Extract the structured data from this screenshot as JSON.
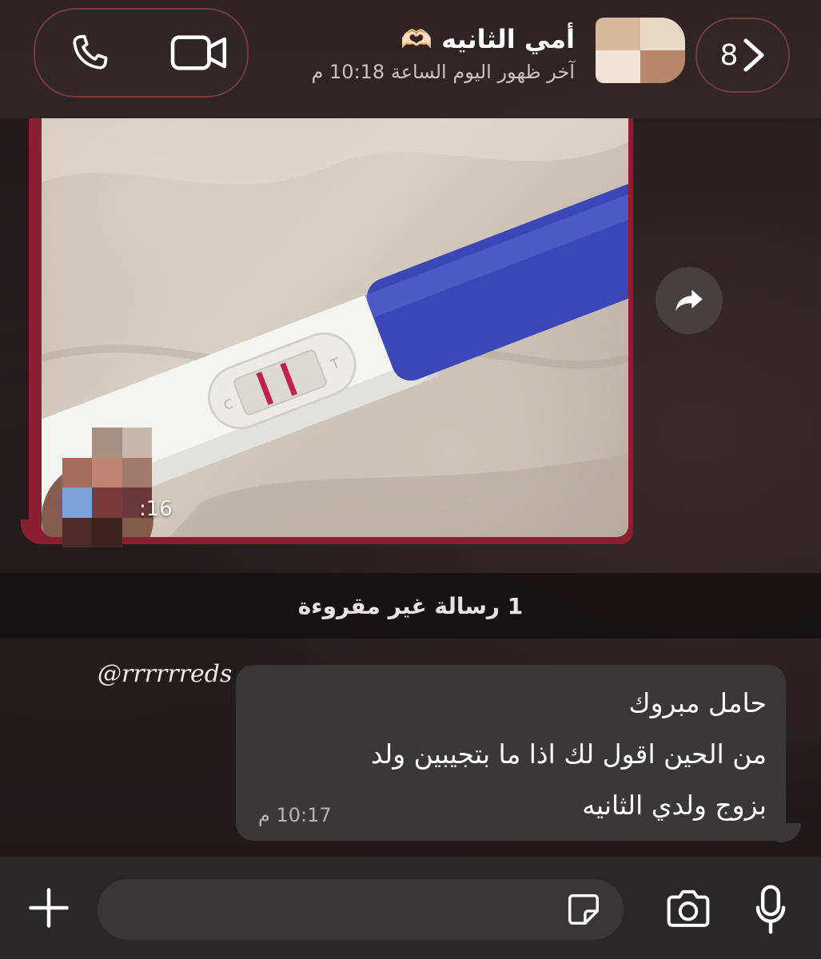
{
  "header": {
    "back_count": "8",
    "contact_name": "أمي الثانيه 🫶🏻",
    "last_seen": "آخر ظهور اليوم الساعة 10:18 م"
  },
  "messages": {
    "image_message": {
      "time_visible": ":16"
    },
    "unread_banner": "1 رسالة غير مقروءة",
    "text_message": {
      "lines": [
        "حامل مبروك",
        "من الحين اقول لك اذا ما بتجيبين ولد",
        "بزوج ولدي الثانيه"
      ],
      "time": "10:17 م"
    }
  },
  "watermark": "@rrrrrreds",
  "composer": {
    "placeholder": ""
  },
  "icons": {
    "call": "phone-icon",
    "video": "video-camera-icon",
    "back": "chevron-right-icon",
    "forward": "forward-arrow-icon",
    "plus": "plus-icon",
    "sticker": "sticker-icon",
    "camera": "camera-icon",
    "mic": "microphone-icon"
  },
  "colors": {
    "accent_border": "#7a3a3a",
    "outgoing_image_bubble": "#8a1f2f",
    "incoming_bubble": "#3b3637",
    "test_handle": "#3b47b8"
  }
}
